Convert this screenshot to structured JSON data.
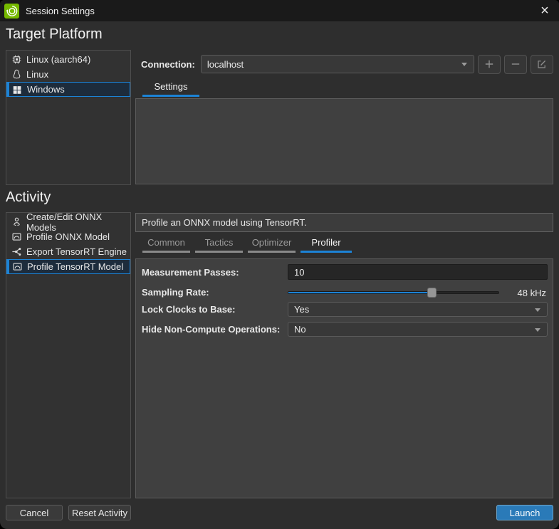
{
  "window": {
    "title": "Session Settings",
    "close_glyph": "×",
    "app_icon": "nsight-green-icon"
  },
  "colors": {
    "accent": "#1c83d6",
    "launch_button": "#2a7ab8",
    "app_icon_green": "#76b900",
    "selected_row_bg": "#1d2c3c"
  },
  "target_platform": {
    "heading": "Target Platform",
    "items": [
      {
        "label": "Linux (aarch64)",
        "icon": "chip-icon",
        "selected": false
      },
      {
        "label": "Linux",
        "icon": "penguin-icon",
        "selected": false
      },
      {
        "label": "Windows",
        "icon": "windows-icon",
        "selected": true
      }
    ],
    "connection": {
      "label": "Connection:",
      "value": "localhost"
    },
    "actions": [
      {
        "name": "add",
        "icon": "plus-icon"
      },
      {
        "name": "remove",
        "icon": "minus-icon"
      },
      {
        "name": "edit",
        "icon": "edit-icon"
      }
    ],
    "tabs": [
      {
        "label": "Settings",
        "active": true
      }
    ]
  },
  "activity": {
    "heading": "Activity",
    "items": [
      {
        "label": "Create/Edit ONNX Models",
        "icon": "user-icon",
        "selected": false
      },
      {
        "label": "Profile ONNX Model",
        "icon": "profile-chart-icon",
        "selected": false
      },
      {
        "label": "Export TensorRT Engine",
        "icon": "network-graph-icon",
        "selected": false
      },
      {
        "label": "Profile TensorRT Model",
        "icon": "profile-chart-icon",
        "selected": true
      }
    ],
    "description": "Profile an ONNX model using TensorRT.",
    "tabs": [
      {
        "label": "Common",
        "active": false
      },
      {
        "label": "Tactics",
        "active": false
      },
      {
        "label": "Optimizer",
        "active": false
      },
      {
        "label": "Profiler",
        "active": true
      }
    ],
    "form": {
      "measurement_passes": {
        "label": "Measurement Passes:",
        "value": "10"
      },
      "sampling_rate": {
        "label": "Sampling Rate:",
        "value_label": "48 kHz",
        "fraction": 0.68
      },
      "lock_clocks": {
        "label": "Lock Clocks to Base:",
        "value": "Yes"
      },
      "hide_non_compute": {
        "label": "Hide Non-Compute Operations:",
        "value": "No"
      }
    }
  },
  "footer": {
    "cancel_label": "Cancel",
    "reset_label": "Reset Activity",
    "launch_label": "Launch"
  }
}
